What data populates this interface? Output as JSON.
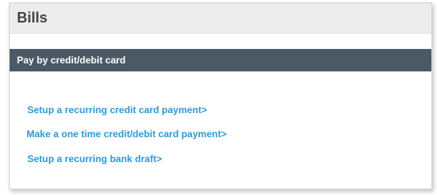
{
  "panel": {
    "title": "Bills"
  },
  "section": {
    "title": "Pay by credit/debit card"
  },
  "links": [
    "Setup a recurring credit card payment>",
    "Make a one time credit/debit card payment>",
    "Setup a recurring bank draft>"
  ],
  "colors": {
    "header_bg": "#ececec",
    "section_bar_bg": "#4b5966",
    "link": "#2a9ad6",
    "title_text": "#444444"
  }
}
